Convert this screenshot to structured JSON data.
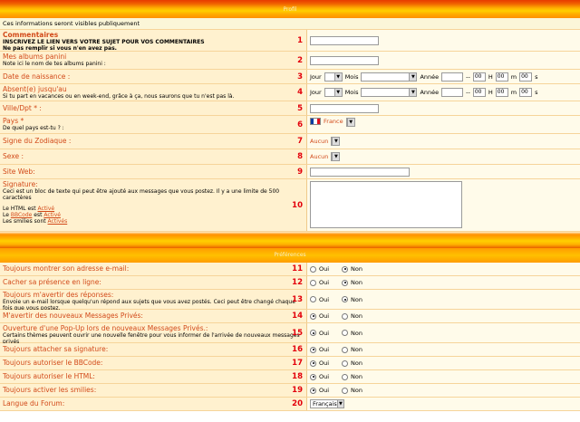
{
  "header": {
    "title": "Profil"
  },
  "info": "Ces informations seront visibles publiquement",
  "comments": {
    "label": "Commentaires",
    "sub1": "INSCRIVEZ LE LIEN VERS VOTRE SUJET POUR VOS COMMENTAIRES",
    "sub2": "Ne pas remplir si vous n'en avez pas.",
    "num": "1"
  },
  "albums": {
    "label": "Mes albums panini",
    "sub": "Note ici le nom de tes albums panini :",
    "num": "2"
  },
  "birth": {
    "label": "Date de naissance :",
    "num": "3",
    "jour": "Jour",
    "mois": "Mois",
    "annee": "Année",
    "dash": "--",
    "h": "H",
    "m": "m",
    "s": "s",
    "hv": "00",
    "mv": "00",
    "sv": "00"
  },
  "absent": {
    "label": "Absent(e) jusqu'au",
    "sub": "Si tu part en vacances ou en week-end, grâce à ça, nous saurons que tu n'est pas là.",
    "num": "4",
    "jour": "Jour",
    "mois": "Mois",
    "annee": "Année",
    "dash": "--",
    "h": "H",
    "m": "m",
    "s": "s",
    "hv": "00",
    "mv": "00",
    "sv": "00"
  },
  "ville": {
    "label": "Ville/Dpt * :",
    "num": "5"
  },
  "pays": {
    "label": "Pays *",
    "sub": "De quel pays est-tu ? :",
    "num": "6",
    "value": "France"
  },
  "zodiac": {
    "label": "Signe du Zodiaque :",
    "num": "7",
    "value": "Aucun"
  },
  "sexe": {
    "label": "Sexe :",
    "num": "8",
    "value": "Aucun"
  },
  "site": {
    "label": "Site Web:",
    "num": "9"
  },
  "signature": {
    "label": "Signature:",
    "sub": "Ceci est un bloc de texte qui peut être ajouté aux messages que vous postez. Il y a une limite de 500 caractères",
    "html": "Le HTML est",
    "html_state": "Activé",
    "bb_pre": "Le",
    "bbcode": "BBCode",
    "bb_mid": "est",
    "bb_state": "Activé",
    "smilies": "Les smilies sont",
    "smilies_state": "Activés",
    "num": "10"
  },
  "prefs_header": "Préférences",
  "oui": "Oui",
  "non": "Non",
  "prefs": [
    {
      "label": "Toujours montrer son adresse e-mail:",
      "num": "11",
      "sel": "non"
    },
    {
      "label": "Cacher sa présence en ligne:",
      "num": "12",
      "sel": "non"
    },
    {
      "label": "Toujours m'avertir des réponses:",
      "sub": "Envoie un e-mail lorsque quelqu'un répond aux sujets que vous avez postés. Ceci peut être changé chaque fois que vous postez.",
      "num": "13",
      "sel": "non"
    },
    {
      "label": "M'avertir des nouveaux Messages Privés:",
      "num": "14",
      "sel": "oui"
    },
    {
      "label": "Ouverture d'une Pop-Up lors de nouveaux Messages Privés.:",
      "sub": "Certains thèmes peuvent ouvrir une nouvelle fenêtre pour vous informer de l'arrivée de nouveaux messages privés",
      "num": "15",
      "sel": "oui"
    },
    {
      "label": "Toujours attacher sa signature:",
      "num": "16",
      "sel": "oui"
    },
    {
      "label": "Toujours autoriser le BBCode:",
      "num": "17",
      "sel": "oui"
    },
    {
      "label": "Toujours autoriser le HTML:",
      "num": "18",
      "sel": "oui"
    },
    {
      "label": "Toujours activer les smilies:",
      "num": "19",
      "sel": "oui"
    }
  ],
  "lang": {
    "label": "Langue du Forum:",
    "num": "20",
    "value": "Français"
  }
}
